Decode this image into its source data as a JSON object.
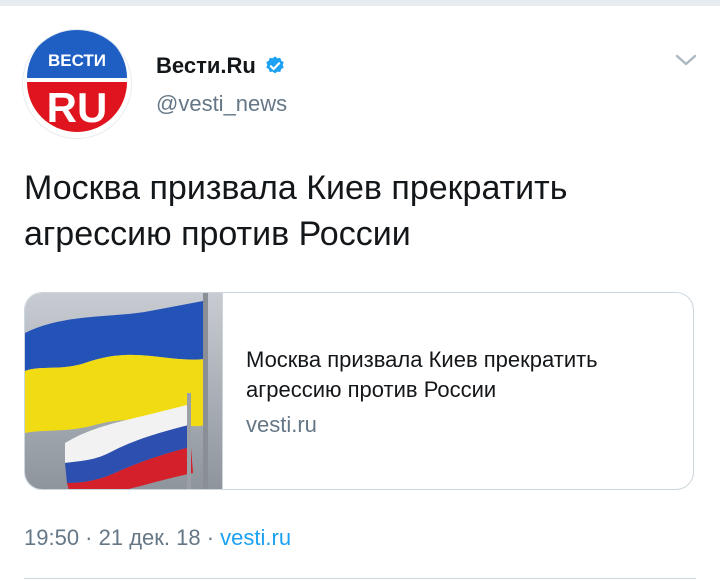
{
  "avatar": {
    "top_text": "ВЕСТИ",
    "bottom_text": "RU",
    "colors": {
      "blue": "#1f5fc4",
      "red": "#e0141e",
      "white": "#ffffff"
    }
  },
  "author": {
    "display_name": "Вести.Ru",
    "handle": "@vesti_news",
    "verified": true,
    "verified_icon": "verified-badge-icon"
  },
  "menu": {
    "icon": "chevron-down-icon"
  },
  "tweet": {
    "text": "Москва призвала Киев прекратить агрессию против России"
  },
  "card": {
    "image": "flags-ukraine-russia",
    "title": "Москва призвала Киев прекратить агрессию против России",
    "domain": "vesti.ru"
  },
  "meta": {
    "time": "19:50",
    "separator": " · ",
    "date": "21 дек. 18",
    "source": "vesti.ru"
  },
  "colors": {
    "text_primary": "#14171a",
    "text_secondary": "#657786",
    "accent": "#1da1f2",
    "border": "#ccd6dd"
  }
}
